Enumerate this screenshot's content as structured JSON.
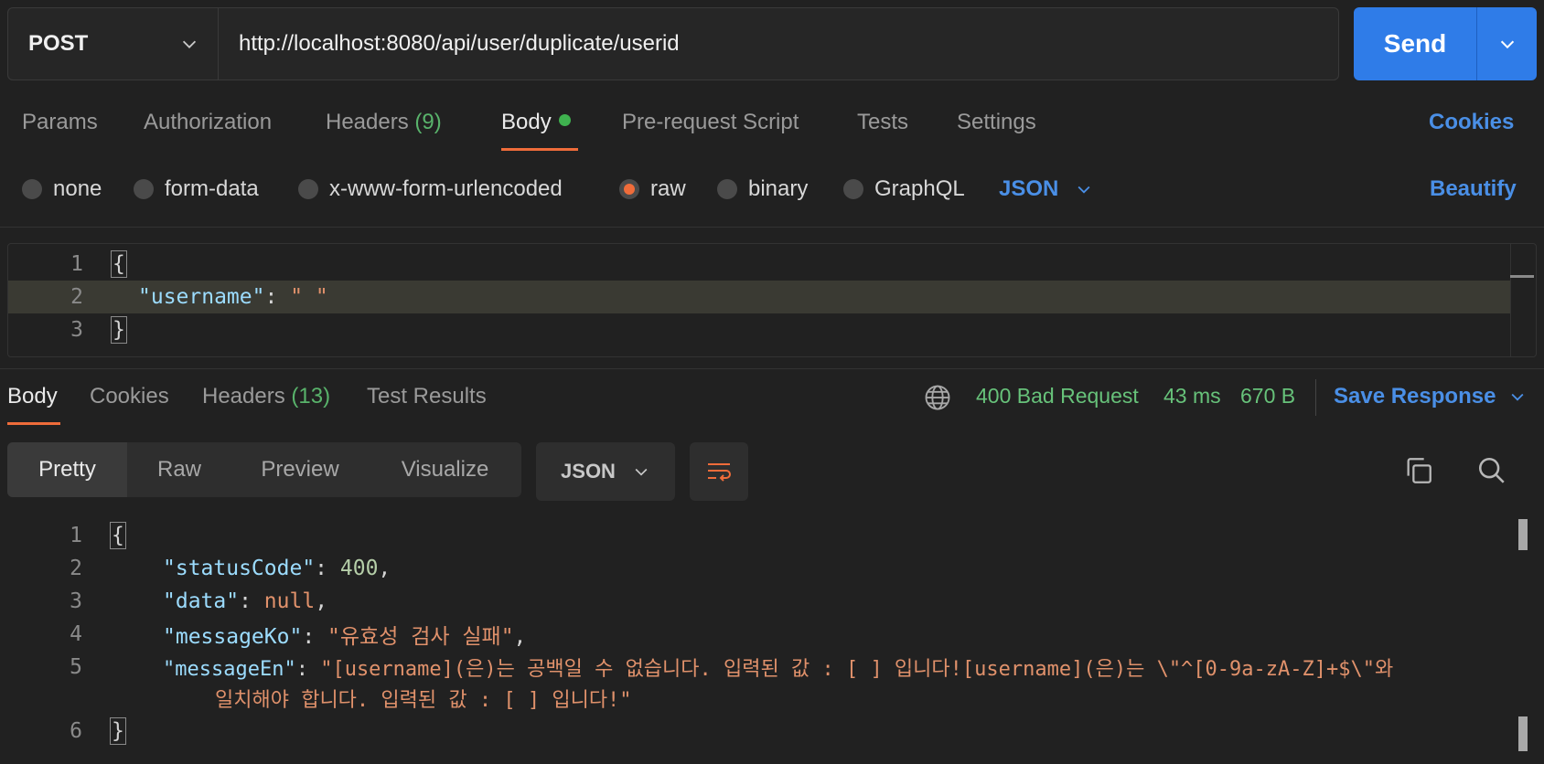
{
  "request": {
    "method": "POST",
    "url": "http://localhost:8080/api/user/duplicate/userid",
    "send_label": "Send"
  },
  "request_tabs": {
    "params": "Params",
    "authorization": "Authorization",
    "headers": "Headers",
    "headers_count": "(9)",
    "body": "Body",
    "pre_request": "Pre-request Script",
    "tests": "Tests",
    "settings": "Settings",
    "cookies": "Cookies"
  },
  "body_types": {
    "none": "none",
    "form_data": "form-data",
    "urlencoded": "x-www-form-urlencoded",
    "raw": "raw",
    "binary": "binary",
    "graphql": "GraphQL",
    "format": "JSON",
    "beautify": "Beautify",
    "selected": "raw"
  },
  "request_body": {
    "line_numbers": [
      "1",
      "2",
      "3"
    ],
    "key": "\"username\"",
    "colon": ": ",
    "value": "\" \""
  },
  "response_tabs": {
    "body": "Body",
    "cookies": "Cookies",
    "headers": "Headers",
    "headers_count": "(13)",
    "test_results": "Test Results"
  },
  "response_status": {
    "status": "400 Bad Request",
    "time": "43 ms",
    "size": "670 B",
    "save_response": "Save Response"
  },
  "response_view": {
    "pretty": "Pretty",
    "raw": "Raw",
    "preview": "Preview",
    "visualize": "Visualize",
    "format": "JSON"
  },
  "response_body": {
    "line_numbers": [
      "1",
      "2",
      "3",
      "4",
      "5",
      "6"
    ],
    "status_key": "\"statusCode\"",
    "status_value": "400",
    "data_key": "\"data\"",
    "data_value": "null",
    "message_ko_key": "\"messageKo\"",
    "message_ko_value": "\"유효성 검사 실패\"",
    "message_en_key": "\"messageEn\"",
    "message_en_value_line1": "\"[username](은)는 공백일 수 없습니다. 입력된 값 : [ ] 입니다![username](은)는 \\\"^[0-9a-zA-Z]+$\\\"와",
    "message_en_value_line2": "일치해야 합니다. 입력된 값 : [ ] 입니다!\""
  },
  "colors": {
    "accent_orange": "#ef6c3a",
    "link_blue": "#4a8fe6",
    "send_blue": "#2f7ce8",
    "status_green": "#67c27a"
  }
}
